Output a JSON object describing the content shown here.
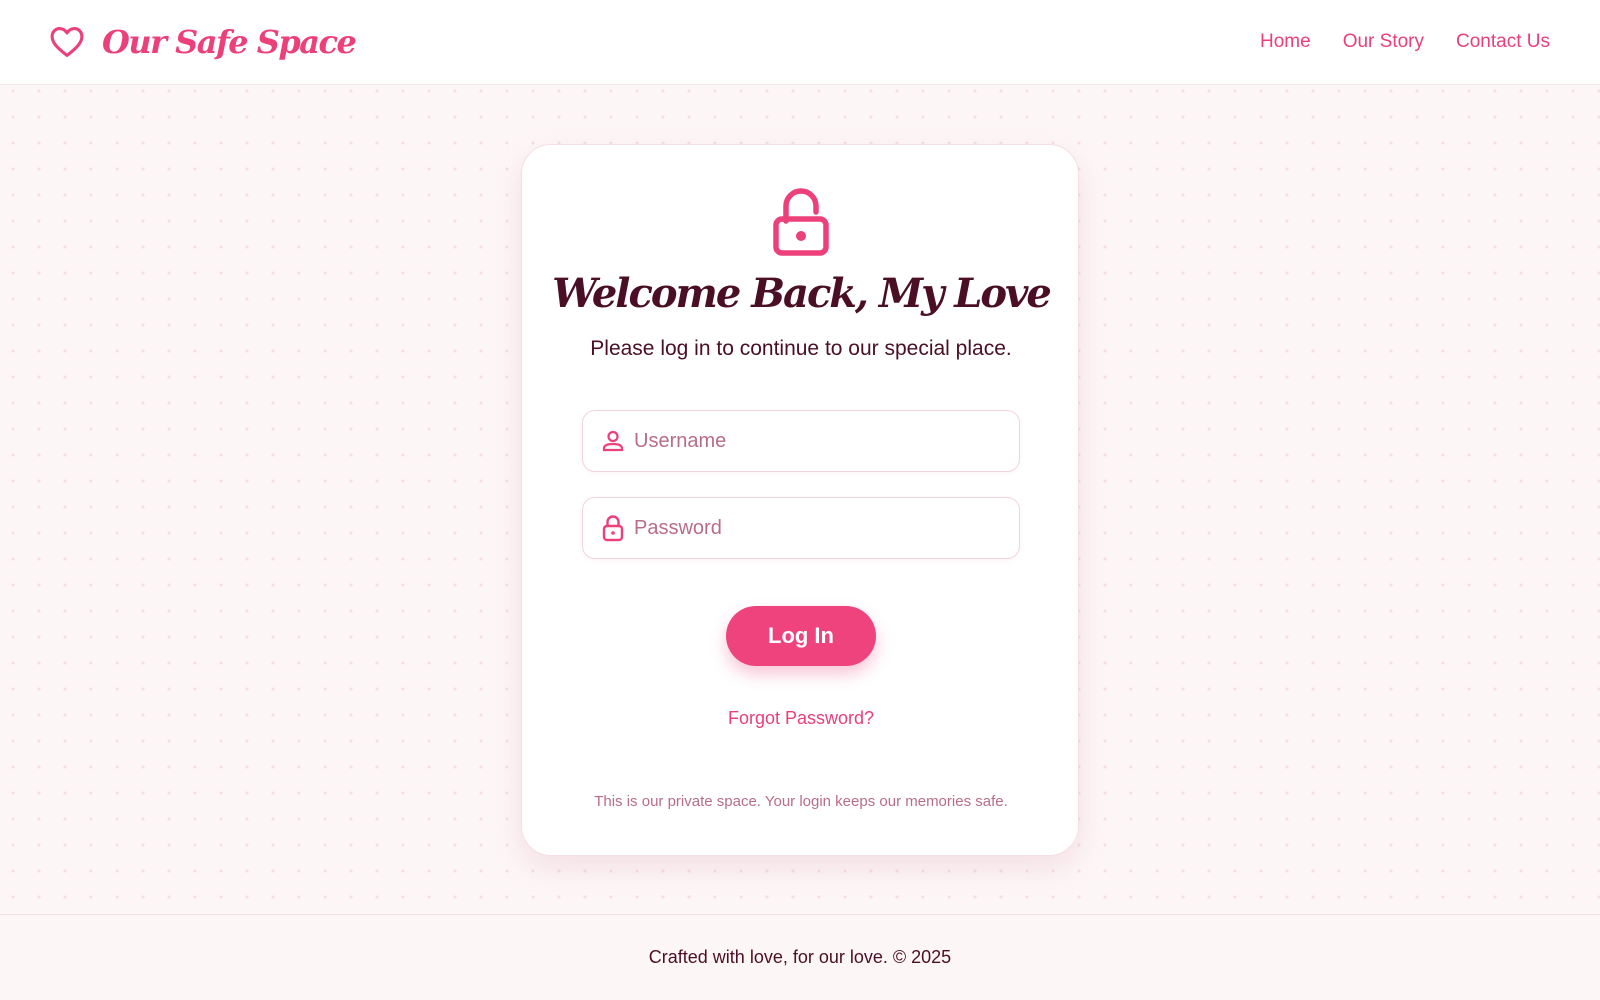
{
  "brand": {
    "name": "Our Safe Space",
    "icon": "heart-icon"
  },
  "nav": {
    "items": [
      {
        "label": "Home"
      },
      {
        "label": "Our Story"
      },
      {
        "label": "Contact Us"
      }
    ]
  },
  "card": {
    "icon": "lock-open-icon",
    "title": "Welcome Back, My Love",
    "subtitle": "Please log in to continue to our special place.",
    "username": {
      "placeholder": "Username",
      "value": "",
      "icon": "user-icon"
    },
    "password": {
      "placeholder": "Password",
      "value": "",
      "icon": "lock-icon"
    },
    "login_label": "Log In",
    "forgot_label": "Forgot Password?",
    "privacy_note": "This is our private space. Your login keeps our memories safe."
  },
  "footer": {
    "text": "Crafted with love, for our love. © 2025"
  },
  "colors": {
    "accent": "#ec407a",
    "text": "#4a0f24",
    "muted": "#b86d87",
    "background": "#fdf6f7"
  }
}
